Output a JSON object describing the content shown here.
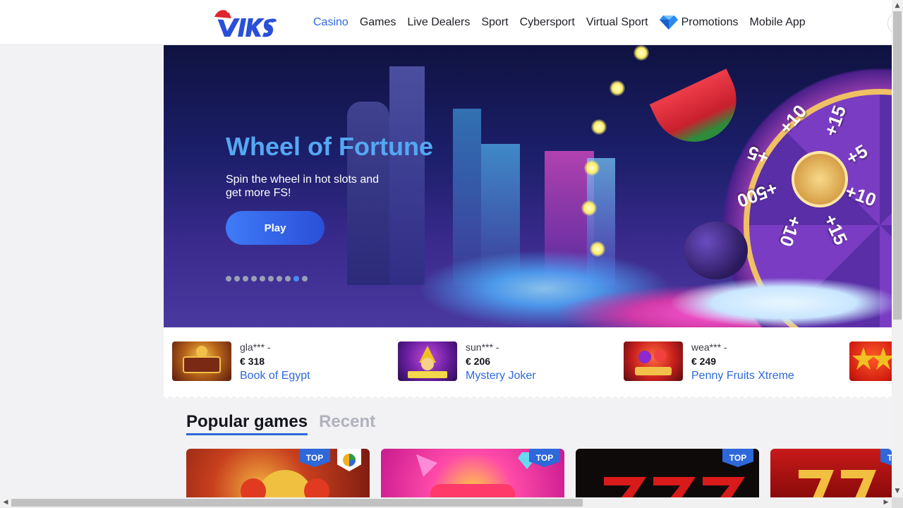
{
  "header": {
    "brand": "VIKS",
    "nav": [
      {
        "label": "Casino",
        "active": true
      },
      {
        "label": "Games",
        "active": false
      },
      {
        "label": "Live Dealers",
        "active": false
      },
      {
        "label": "Sport",
        "active": false
      },
      {
        "label": "Cybersport",
        "active": false
      },
      {
        "label": "Virtual Sport",
        "active": false
      },
      {
        "label": "Promotions",
        "active": false,
        "icon": "diamond-icon"
      },
      {
        "label": "Mobile App",
        "active": false
      }
    ]
  },
  "banner": {
    "title": "Wheel of Fortune",
    "subtitle": "Spin the wheel in hot slots and get more FS!",
    "play_label": "Play",
    "slide_count": 10,
    "active_slide": 9,
    "wheel_labels": [
      "+10",
      "+15",
      "+5",
      "+10",
      "+15",
      "+10",
      "+500",
      "+5"
    ]
  },
  "winners": [
    {
      "user": "gla*** -",
      "amount": "€ 318",
      "game": "Book of Egypt"
    },
    {
      "user": "sun*** -",
      "amount": "€ 206",
      "game": "Mystery Joker"
    },
    {
      "user": "wea*** -",
      "amount": "€ 249",
      "game": "Penny Fruits Xtreme"
    }
  ],
  "popular": {
    "tabs": [
      "Popular games",
      "Recent"
    ],
    "badge_top": "TOP"
  },
  "colors": {
    "accent": "#2e68d9",
    "title_blue": "#54a8f2"
  }
}
